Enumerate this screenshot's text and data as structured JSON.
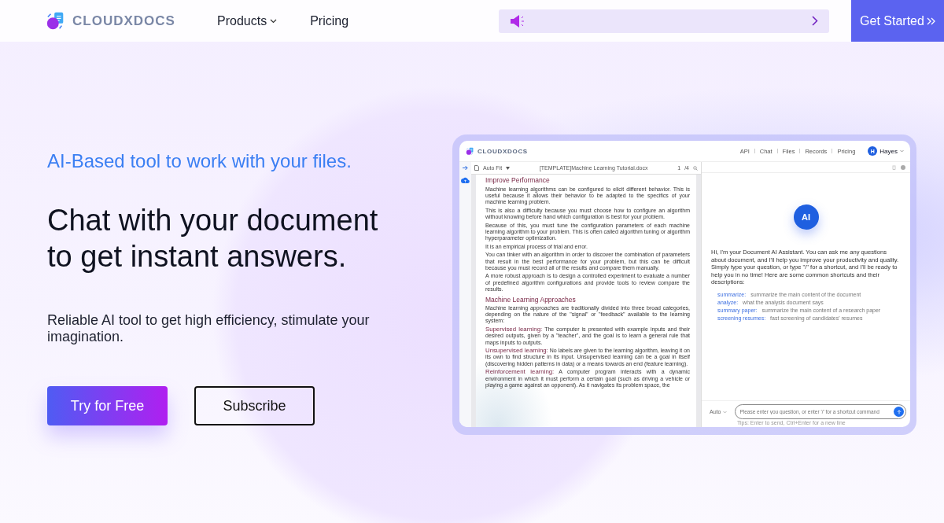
{
  "header": {
    "brand": "CLOUDXDOCS",
    "nav": [
      {
        "label": "Products",
        "dropdown": true
      },
      {
        "label": "Pricing",
        "dropdown": false
      }
    ],
    "cta": "Get Started"
  },
  "hero": {
    "tagline": "AI-Based tool to work with your files.",
    "title_lines": [
      "Chat with your document",
      "to get instant answers."
    ],
    "description": "Reliable AI tool to get high efficiency, stimulate your imagination.",
    "buttons": [
      {
        "label": "Try for Free",
        "kind": "primary"
      },
      {
        "label": "Subscribe",
        "kind": "outline"
      }
    ]
  },
  "app": {
    "brand": "CLOUDXDOCS",
    "nav": [
      "API",
      "Chat",
      "Files",
      "Records",
      "Pricing"
    ],
    "user": {
      "initial": "H",
      "name": "Hayes"
    },
    "viewer": {
      "zoom": "Auto Fit",
      "file": "[TEMPLATE]Machine Learning Tutorial.docx",
      "page": "1",
      "pages": "/4",
      "blocks": [
        {
          "kind": "heading",
          "text": "Improve Performance"
        },
        {
          "kind": "para",
          "text": "Machine learning algorithms can be configured to elicit different behavior. This is useful because it allows their behavior to be adapted to the specifics of your machine learning problem."
        },
        {
          "kind": "para",
          "text": "This is also a difficulty because you must choose how to configure an algorithm without knowing before hand which configuration is best for your problem."
        },
        {
          "kind": "para",
          "text": "Because of this, you must tune the configuration parameters of each machine learning algorithm to your problem. This is often called algorithm tuning or algorithm hyperparameter optimization."
        },
        {
          "kind": "para",
          "text": "It is an empirical process of trial and error."
        },
        {
          "kind": "para",
          "text": "You can tinker with an algorithm in order to discover the combination of parameters that result in the best performance for your problem, but this can be difficult because you must record all of the results and compare them manually."
        },
        {
          "kind": "para",
          "text": "A more robust approach is to design a controlled experiment to evaluate a number of predefined algorithm configurations and provide tools to review compare the results."
        },
        {
          "kind": "heading",
          "text": "Machine Learning Approaches"
        },
        {
          "kind": "para",
          "text": "Machine learning approaches are traditionally divided into three broad categories, depending on the nature of the \"signal\" or \"feedback\" available to the learning system:"
        },
        {
          "kind": "term",
          "term": "Supervised learning:",
          "text": "The computer is presented with example inputs and their desired outputs, given by a \"teacher\", and the goal is to learn a general rule that maps inputs to outputs."
        },
        {
          "kind": "term",
          "term": "Unsupervised learning:",
          "text": "No labels are given to the learning algorithm, leaving it on its own to find structure in its input. Unsupervised learning can be a goal in itself (discovering hidden patterns in data) or a means towards an end (feature learning)."
        },
        {
          "kind": "term",
          "term": "Reinforcement learning:",
          "text": "A computer program interacts with a dynamic environment in which it must perform a certain goal (such as driving a vehicle or playing a game against an opponent). As it navigates its problem space, the"
        }
      ]
    },
    "chat": {
      "badge": "AI",
      "message": "Hi, I'm your Document AI Assistant. You can ask me any questions about document, and I'll help you improve your productivity and quality. Simply type your question, or type \"/\" for a shortcut, and I'll be ready to help you in no time! Here are some common shortcuts and their descriptions:",
      "shortcuts": [
        {
          "key": "summarize:",
          "desc": "summarize the main content of the document"
        },
        {
          "key": "analyze:",
          "desc": "what the analysis document says"
        },
        {
          "key": "summary paper:",
          "desc": "summarize the main content of a research paper"
        },
        {
          "key": "screening resumes:",
          "desc": "fast screening of candidates' resumes"
        }
      ],
      "mode": "Auto",
      "placeholder": "Please enter you question, or enter '/' for a shortcut command",
      "hint": "Tips: Enter to send, Ctrl+Enter for a new line"
    }
  }
}
